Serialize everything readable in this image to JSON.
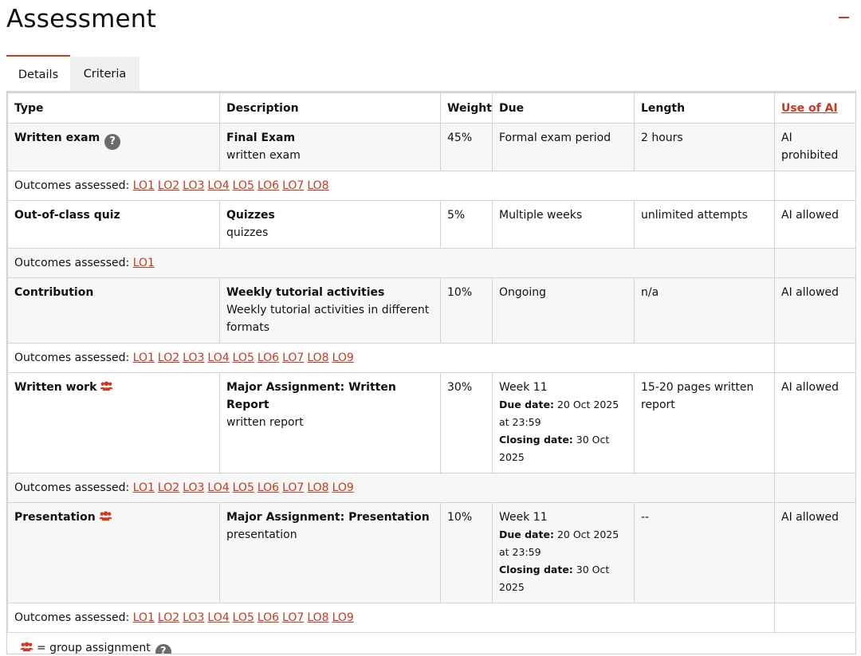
{
  "page": {
    "title": "Assessment"
  },
  "tabs": [
    {
      "label": "Details",
      "active": true
    },
    {
      "label": "Criteria",
      "active": false
    }
  ],
  "table": {
    "headers": {
      "type": "Type",
      "description": "Description",
      "weight": "Weight",
      "due": "Due",
      "length": "Length",
      "ai": "Use of AI"
    },
    "outcomes_label": "Outcomes assessed:",
    "due_date_label": "Due date:",
    "closing_date_label": "Closing date:",
    "rows": [
      {
        "type": "Written exam",
        "desc_title": "Final Exam",
        "desc_sub": "written exam",
        "weight": "45%",
        "due": "Formal exam period",
        "length": "2 hours",
        "ai": "AI prohibited",
        "outcomes": [
          "LO1",
          "LO2",
          "LO3",
          "LO4",
          "LO5",
          "LO6",
          "LO7",
          "LO8"
        ]
      },
      {
        "type": "Out-of-class quiz",
        "desc_title": "Quizzes",
        "desc_sub": "quizzes",
        "weight": "5%",
        "due": "Multiple weeks",
        "length": "unlimited attempts",
        "ai": "AI allowed",
        "outcomes": [
          "LO1"
        ]
      },
      {
        "type": "Contribution",
        "desc_title": "Weekly tutorial activities",
        "desc_sub": "Weekly tutorial activities in different formats",
        "weight": "10%",
        "due": "Ongoing",
        "length": "n/a",
        "ai": "AI allowed",
        "outcomes": [
          "LO1",
          "LO2",
          "LO3",
          "LO4",
          "LO5",
          "LO6",
          "LO7",
          "LO8",
          "LO9"
        ]
      },
      {
        "type": "Written work",
        "desc_title": "Major Assignment: Written Report",
        "desc_sub": "written report",
        "weight": "30%",
        "due": "Week 11",
        "due_date": "20 Oct 2025 at 23:59",
        "closing_date": "30 Oct 2025",
        "length": "15-20 pages written report",
        "ai": "AI allowed",
        "outcomes": [
          "LO1",
          "LO2",
          "LO3",
          "LO4",
          "LO5",
          "LO6",
          "LO7",
          "LO8",
          "LO9"
        ]
      },
      {
        "type": "Presentation",
        "desc_title": "Major Assignment: Presentation",
        "desc_sub": "presentation",
        "weight": "10%",
        "due": "Week 11",
        "due_date": "20 Oct 2025 at 23:59",
        "closing_date": "30 Oct 2025",
        "length": "--",
        "ai": "AI allowed",
        "outcomes": [
          "LO1",
          "LO2",
          "LO3",
          "LO4",
          "LO5",
          "LO6",
          "LO7",
          "LO8",
          "LO9"
        ]
      }
    ]
  },
  "legend": {
    "text": "= group assignment"
  },
  "icons": {
    "help": "question-circle-icon",
    "group": "group-people-icon",
    "collapse": "minus-icon"
  },
  "colors": {
    "accent": "#d0391f",
    "link": "#c8391f",
    "help_icon": "#6b6b6b"
  }
}
